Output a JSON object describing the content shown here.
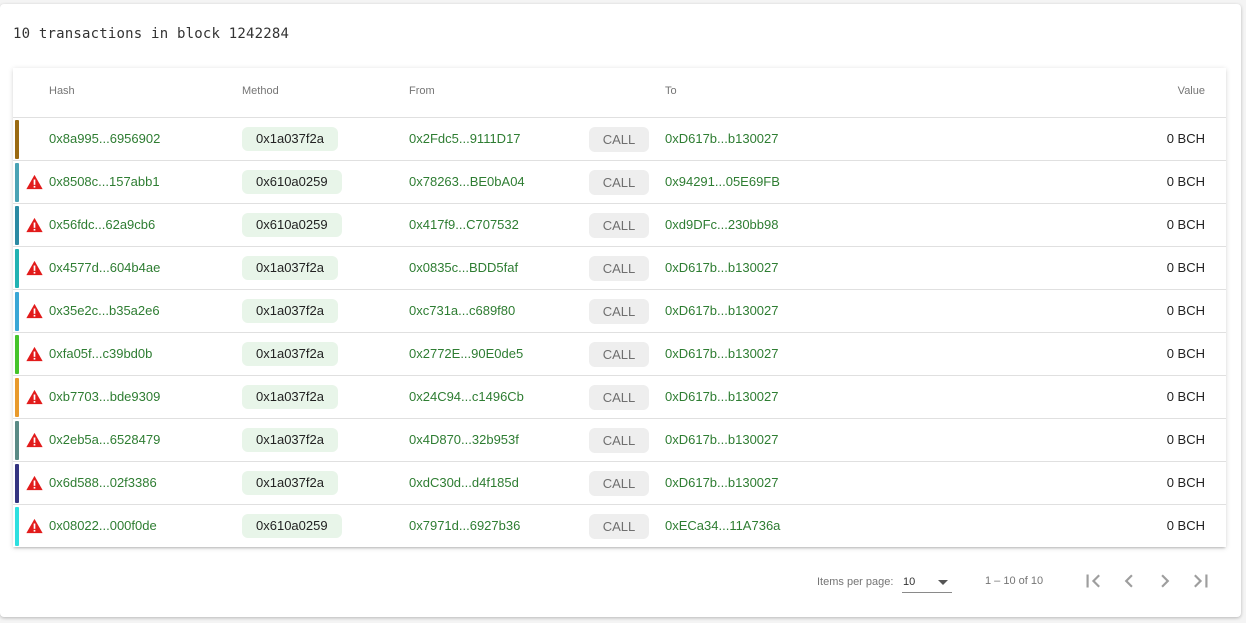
{
  "header": {
    "title": "10 transactions in block 1242284"
  },
  "table": {
    "columns": {
      "hash": "Hash",
      "method": "Method",
      "from": "From",
      "to": "To",
      "value": "Value"
    },
    "rows": [
      {
        "color": "#9a6a12",
        "warning": false,
        "hash": "0x8a995...6956902",
        "method": "0x1a037f2a",
        "from": "0x2Fdc5...9111D17",
        "type": "CALL",
        "to": "0xD617b...b130027",
        "value": "0 BCH"
      },
      {
        "color": "#4aa3b5",
        "warning": true,
        "hash": "0x8508c...157abb1",
        "method": "0x610a0259",
        "from": "0x78263...BE0bA04",
        "type": "CALL",
        "to": "0x94291...05E69FB",
        "value": "0 BCH"
      },
      {
        "color": "#2b8aa3",
        "warning": true,
        "hash": "0x56fdc...62a9cb6",
        "method": "0x610a0259",
        "from": "0x417f9...C707532",
        "type": "CALL",
        "to": "0xd9DFc...230bb98",
        "value": "0 BCH"
      },
      {
        "color": "#21b3b3",
        "warning": true,
        "hash": "0x4577d...604b4ae",
        "method": "0x1a037f2a",
        "from": "0x0835c...BDD5faf",
        "type": "CALL",
        "to": "0xD617b...b130027",
        "value": "0 BCH"
      },
      {
        "color": "#3aa7d6",
        "warning": true,
        "hash": "0x35e2c...b35a2e6",
        "method": "0x1a037f2a",
        "from": "0xc731a...c689f80",
        "type": "CALL",
        "to": "0xD617b...b130027",
        "value": "0 BCH"
      },
      {
        "color": "#45c42a",
        "warning": true,
        "hash": "0xfa05f...c39bd0b",
        "method": "0x1a037f2a",
        "from": "0x2772E...90E0de5",
        "type": "CALL",
        "to": "0xD617b...b130027",
        "value": "0 BCH"
      },
      {
        "color": "#e89a2c",
        "warning": true,
        "hash": "0xb7703...bde9309",
        "method": "0x1a037f2a",
        "from": "0x24C94...c1496Cb",
        "type": "CALL",
        "to": "0xD617b...b130027",
        "value": "0 BCH"
      },
      {
        "color": "#5a8a85",
        "warning": true,
        "hash": "0x2eb5a...6528479",
        "method": "0x1a037f2a",
        "from": "0x4D870...32b953f",
        "type": "CALL",
        "to": "0xD617b...b130027",
        "value": "0 BCH"
      },
      {
        "color": "#343480",
        "warning": true,
        "hash": "0x6d588...02f3386",
        "method": "0x1a037f2a",
        "from": "0xdC30d...d4f185d",
        "type": "CALL",
        "to": "0xD617b...b130027",
        "value": "0 BCH"
      },
      {
        "color": "#2ee0e0",
        "warning": true,
        "hash": "0x08022...000f0de",
        "method": "0x610a0259",
        "from": "0x7971d...6927b36",
        "type": "CALL",
        "to": "0xECa34...11A736a",
        "value": "0 BCH"
      }
    ]
  },
  "paginator": {
    "items_per_page_label": "Items per page:",
    "items_per_page": "10",
    "range_label": "1 – 10 of 10",
    "buttons": [
      "first-page-icon",
      "previous-page-icon",
      "next-page-icon",
      "last-page-icon"
    ]
  },
  "colors": {
    "link": "#2e7d32",
    "method_bg": "#e8f5e9",
    "call_bg": "#eeeeee",
    "warning": "#e21b1b"
  }
}
